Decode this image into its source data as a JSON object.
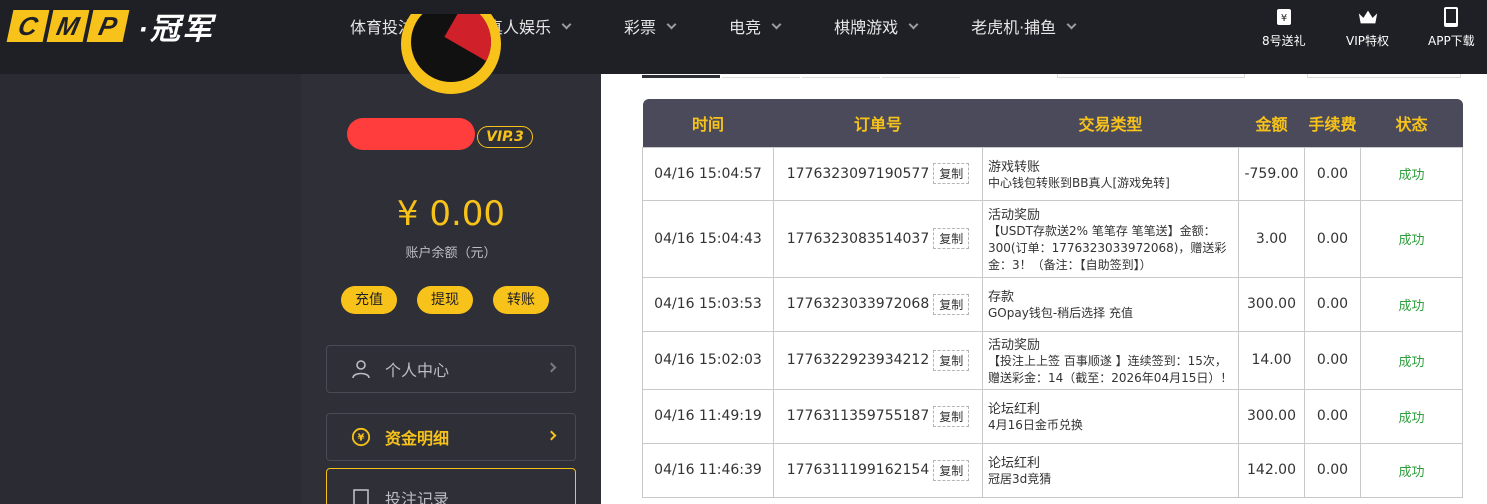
{
  "header": {
    "logo_letters": [
      "C",
      "M",
      "P"
    ],
    "logo_text": "·冠军",
    "nav": [
      {
        "label": "体育投注"
      },
      {
        "label": "真人娱乐"
      },
      {
        "label": "彩票"
      },
      {
        "label": "电竞"
      },
      {
        "label": "棋牌游戏"
      },
      {
        "label": "老虎机·捕鱼"
      }
    ],
    "utilities": [
      {
        "label": "8号送礼",
        "icon": "ticket-icon"
      },
      {
        "label": "VIP特权",
        "icon": "crown-icon"
      },
      {
        "label": "APP下载",
        "icon": "phone-icon"
      }
    ]
  },
  "sidebar": {
    "vip_level": "VIP.3",
    "balance": "¥ 0.00",
    "balance_label": "账户余额（元）",
    "actions": [
      "充值",
      "提现",
      "转账"
    ],
    "menu": [
      {
        "label": "个人中心",
        "icon": "user-icon"
      },
      {
        "label": "资金明细",
        "icon": "yen-coin-icon"
      },
      {
        "label": "投注记录",
        "icon": "document-icon"
      }
    ]
  },
  "table": {
    "headers": [
      "时间",
      "订单号",
      "交易类型",
      "金额",
      "手续费",
      "状态"
    ],
    "copy_label": "复制",
    "rows": [
      {
        "time": "04/16 15:04:57",
        "order": "1776323097190577",
        "type_title": "游戏转账",
        "type_desc": "中心钱包转账到BB真人[游戏免转]",
        "amount": "-759.00",
        "fee": "0.00",
        "status": "成功"
      },
      {
        "time": "04/16 15:04:43",
        "order": "1776323083514037",
        "type_title": "活动奖励",
        "type_desc": "【USDT存款送2% 笔笔存 笔笔送】金额：300(订单：1776323033972068)，赠送彩金：3！（备注：【自助签到】）",
        "amount": "3.00",
        "fee": "0.00",
        "status": "成功"
      },
      {
        "time": "04/16 15:03:53",
        "order": "1776323033972068",
        "type_title": "存款",
        "type_desc": "GOpay钱包-稍后选择 充值",
        "amount": "300.00",
        "fee": "0.00",
        "status": "成功"
      },
      {
        "time": "04/16 15:02:03",
        "order": "1776322923934212",
        "type_title": "活动奖励",
        "type_desc": "【投注上上签 百事顺遂 】连续签到：15次，赠送彩金：14（截至：2026年04月15日）！",
        "amount": "14.00",
        "fee": "0.00",
        "status": "成功"
      },
      {
        "time": "04/16 11:49:19",
        "order": "1776311359755187",
        "type_title": "论坛红利",
        "type_desc": "4月16日金币兑换",
        "amount": "300.00",
        "fee": "0.00",
        "status": "成功"
      },
      {
        "time": "04/16 11:46:39",
        "order": "1776311199162154",
        "type_title": "论坛红利",
        "type_desc": "冠居3d竞猜",
        "amount": "142.00",
        "fee": "0.00",
        "status": "成功"
      }
    ]
  }
}
